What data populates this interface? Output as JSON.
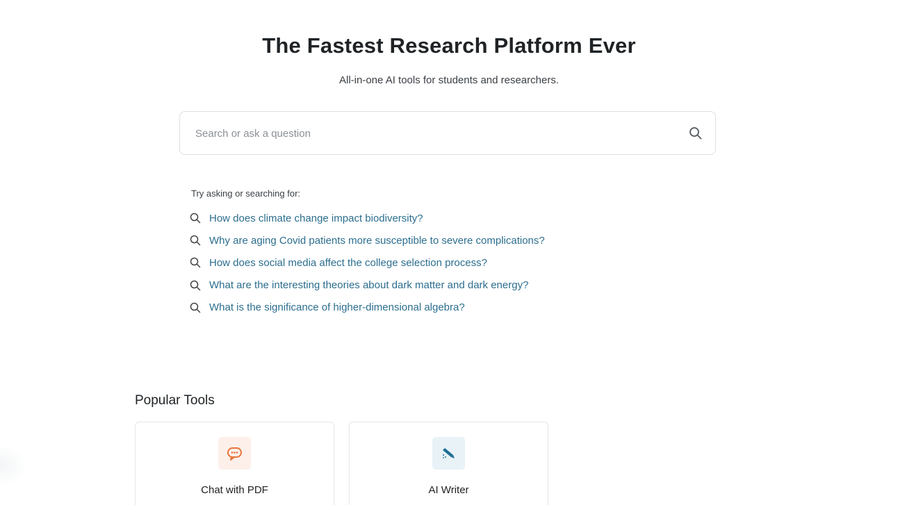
{
  "hero": {
    "title": "The Fastest Research Platform Ever",
    "subtitle": "All-in-one AI tools for students and researchers."
  },
  "search": {
    "placeholder": "Search or ask a question",
    "value": "",
    "button_icon": "search-icon"
  },
  "suggestions": {
    "label": "Try asking or searching for:",
    "icon": "search-icon",
    "items": [
      "How does climate change impact biodiversity?",
      "Why are aging Covid patients more susceptible to severe complications?",
      "How does social media affect the college selection process?",
      "What are the interesting theories about dark matter and dark energy?",
      "What is the significance of higher-dimensional algebra?"
    ]
  },
  "popular_tools": {
    "title": "Popular Tools",
    "tools": [
      {
        "label": "Chat with PDF",
        "icon": "chat-icon",
        "accent": "#e8743b",
        "bg": "#fdf0ea"
      },
      {
        "label": "AI Writer",
        "icon": "pen-icon",
        "accent": "#1f6e93",
        "bg": "#e8f2f7"
      }
    ]
  },
  "colors": {
    "link": "#2c6e8e",
    "title": "#1f2326",
    "border": "#dcdfe3"
  }
}
